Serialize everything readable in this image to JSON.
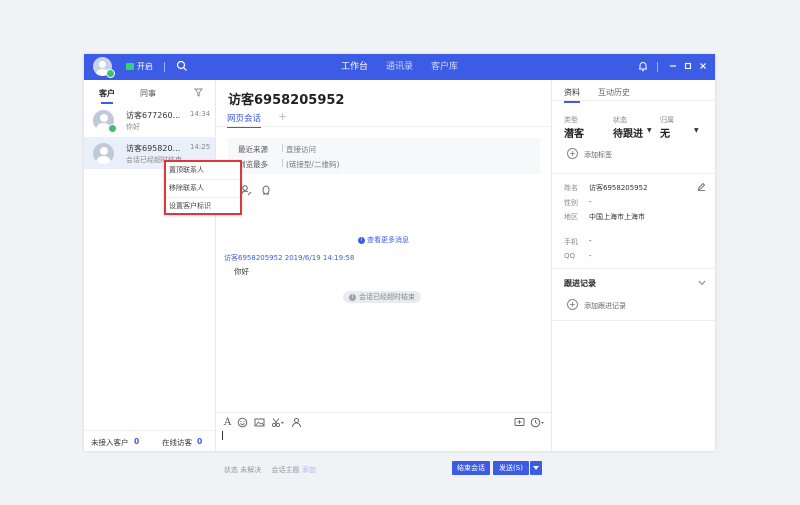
{
  "topbar": {
    "status_label": "开启",
    "nav": [
      "工作台",
      "通讯录",
      "客户库"
    ]
  },
  "left": {
    "tabs": [
      "客户",
      "同事"
    ],
    "conversations": [
      {
        "name": "访客677260...",
        "time": "14:34",
        "message": "你好"
      },
      {
        "name": "访客695820...",
        "time": "14:25",
        "message": "会话已经超时结束"
      }
    ],
    "footer": {
      "unanswered_label": "未接入客户",
      "unanswered_count": "0",
      "online_label": "在线访客",
      "online_count": "0"
    }
  },
  "context_menu": [
    "置顶联系人",
    "移除联系人",
    "设置客户标识"
  ],
  "chat": {
    "title": "访客6958205952",
    "tab": "网页会话",
    "info": [
      {
        "key": "最近来源",
        "value": "直接访问"
      },
      {
        "key": "浏览最多",
        "value": "(链接型/二维码)"
      }
    ],
    "more_link": "查看更多消息",
    "message_header": "访客6958205952 2019/6/19 14:19:58",
    "message_body": "你好",
    "notice": "会话已经超时结束",
    "footer": {
      "status_label": "状态",
      "status_value": "未解决",
      "topic_label": "会话主题",
      "topic_add": "添加"
    },
    "end_button": "结束会话",
    "send_button": "发送(S)"
  },
  "right": {
    "tabs": [
      "资料",
      "互动历史"
    ],
    "type_label": "类型",
    "type_value": "潜客",
    "status_label": "状态",
    "status_value": "待跟进",
    "owner_label": "归属",
    "owner_value": "无",
    "add_tag": "添加标签",
    "fields": [
      {
        "label": "姓名",
        "value": "访客6958205952"
      },
      {
        "label": "性别",
        "value": "-"
      },
      {
        "label": "地区",
        "value": "中国上海市上海市"
      },
      {
        "label": "手机",
        "value": "-"
      },
      {
        "label": "QQ",
        "value": "-"
      }
    ],
    "follow_title": "跟进记录",
    "add_follow": "添加跟进记录"
  }
}
